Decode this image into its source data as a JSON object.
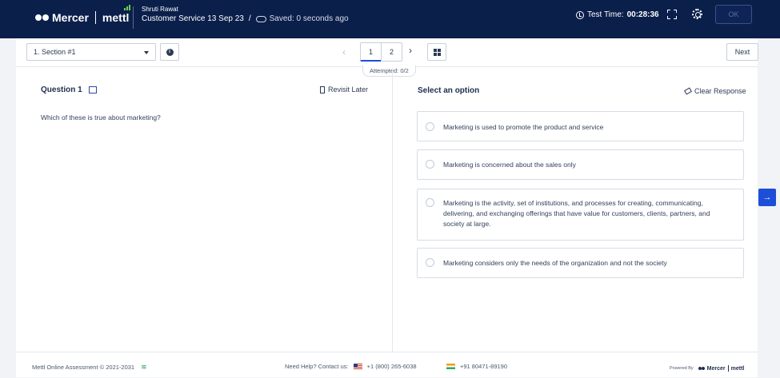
{
  "header": {
    "brand_mercer": "Mercer",
    "brand_mettl": "mettl",
    "candidate_name": "Shruti Rawat",
    "test_name": "Customer Service 13 Sep 23",
    "separator": "/",
    "saved_status": "Saved: 0 seconds ago",
    "test_time_label": "Test Time:",
    "test_time_value": "00:28:36",
    "ok_label": "OK"
  },
  "toolbar": {
    "section_selected": "1. Section #1",
    "pages": [
      "1",
      "2"
    ],
    "current_page": "1",
    "attempted": "Attempted: 0/2",
    "next_label": "Next"
  },
  "question": {
    "title": "Question 1",
    "revisit_label": "Revisit Later",
    "text": "Which of these is true about marketing?"
  },
  "answers": {
    "select_label": "Select an option",
    "clear_label": "Clear Response",
    "options": [
      "Marketing is used to promote the product and service",
      "Marketing is concerned about the sales only",
      "Marketing is the activity, set of institutions, and processes for creating, communicating, delivering, and exchanging offerings that have value for customers, clients, partners, and society at large.",
      "Marketing considers only the needs of the organization and not the society"
    ]
  },
  "footer": {
    "copyright": "Mettl Online Assessment © 2021-2031",
    "help_label": "Need Help? Contact us:",
    "phone_us": "+1 (800) 265-6038",
    "phone_in": "+91 80471-89190",
    "powered_by": "Powered By",
    "powered_mercer": "Mercer",
    "powered_mettl": "mettl"
  },
  "icons": {
    "clock": "clock-icon",
    "fullscreen": "fullscreen-icon",
    "settings": "gear-icon",
    "info": "info-icon",
    "grid": "grid-icon",
    "flag": "flag-icon",
    "bookmark": "bookmark-icon",
    "eraser": "eraser-icon",
    "wifi": "wifi-icon",
    "arrow": "arrow-right-icon"
  },
  "colors": {
    "header_bg": "#0b1f4b",
    "accent": "#1d4ed8",
    "connection_ok": "#1ca35a"
  }
}
